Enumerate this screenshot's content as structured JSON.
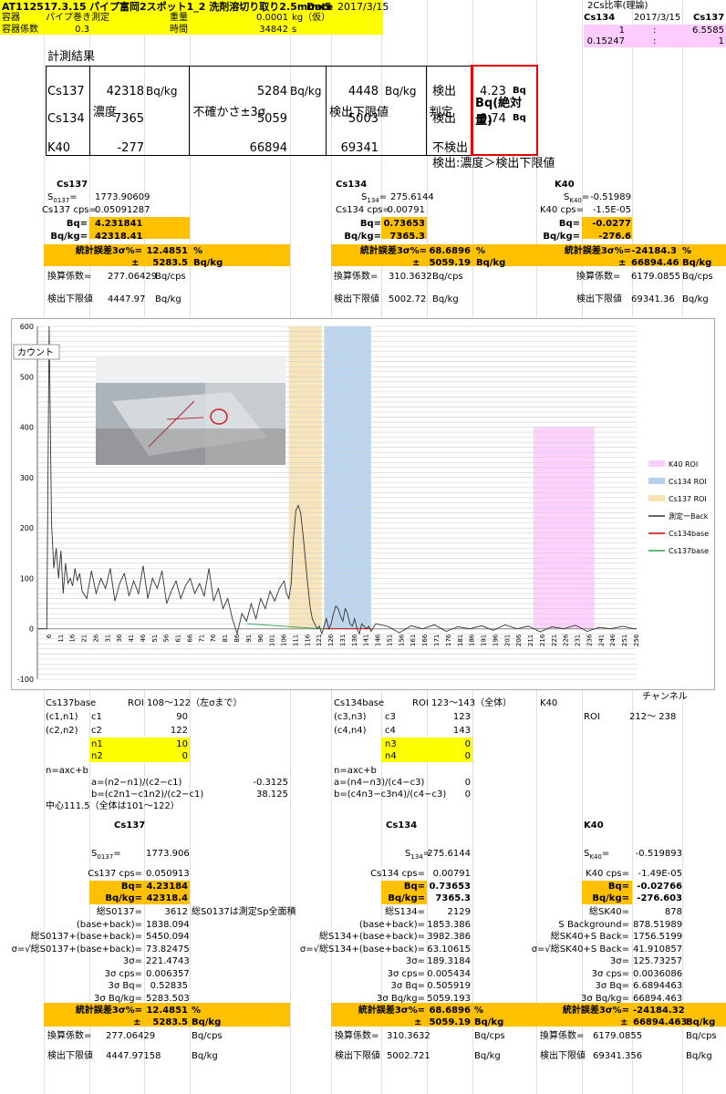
{
  "header": {
    "id": "AT1125",
    "date_code": "17.3.15",
    "title": "パイプ富岡2スポット1_2 洗剤溶切り取り2.5mmx5",
    "date_label": "Date",
    "date": "2017/3/15",
    "r2_l": "容器",
    "r2_v": "パイプ巻き測定",
    "r2_m": "重量",
    "r2_n": "0.0001",
    "r2_u": "kg（仮）",
    "r3_l": "容器係数",
    "r3_v": "0.3",
    "r3_m": "時間",
    "r3_n": "34842",
    "r3_u": "s"
  },
  "ratio": {
    "title": "2Cs比率(理論)",
    "h1": "Cs134",
    "h2": "2017/3/15",
    "h3": "Cs137",
    "r1a": "1",
    "r1b": ":",
    "r1c": "6.5585",
    "r2a": "0.15247",
    "r2b": ":",
    "r2c": "1"
  },
  "results": {
    "title": "計測結果",
    "headers": [
      "濃度",
      "不確かさ±3σ",
      "検出下限値",
      "判定",
      "Bq(絶対量)"
    ],
    "rows": [
      {
        "nuc": "Cs137",
        "conc": "42318",
        "cu": "Bq/kg",
        "unc": "5284",
        "uu": "Bq/kg",
        "lim": "4448",
        "lu": "Bq/kg",
        "judge": "検出",
        "abs": "4.23",
        "au": "Bq"
      },
      {
        "nuc": "Cs134",
        "conc": "7365",
        "cu": "",
        "unc": "5059",
        "uu": "",
        "lim": "5003",
        "lu": "",
        "judge": "検出",
        "abs": "0.74",
        "au": "Bq"
      },
      {
        "nuc": "K40",
        "conc": "-277",
        "cu": "",
        "unc": "66894",
        "uu": "",
        "lim": "69341",
        "lu": "",
        "judge": "不検出",
        "abs": "",
        "au": ""
      }
    ],
    "note": "検出:濃度＞検出下限値"
  },
  "upper": {
    "cs137": {
      "title": "Cs137",
      "s_l": "S",
      "s_sub": "0137",
      "s_v": "1773.90609",
      "cps_l": "Cs137 cps=",
      "cps_v": "0.05091287",
      "bq_l": "Bq=",
      "bq_v": "4.231841",
      "bqkg_l": "Bq/kg=",
      "bqkg_v": "42318.41",
      "err_l": "統計誤差3σ%=",
      "err_v": "12.4851",
      "err_u": "%",
      "pm": "±",
      "pm_v": "5283.5",
      "pm_u": "Bq/kg",
      "conv_l": "換算係数=",
      "conv_v": "277.06429",
      "conv_u": "Bq/cps",
      "lim_l": "検出下限値",
      "lim_v": "4447.97",
      "lim_u": "Bq/kg"
    },
    "cs134": {
      "title": "Cs134",
      "s_l": "S",
      "s_sub": "134",
      "s_v": "275.6144",
      "cps_l": "Cs134 cps=",
      "cps_v": "0.00791",
      "bq_l": "Bq=",
      "bq_v": "0.73653",
      "bqkg_l": "Bq/kg=",
      "bqkg_v": "7365.3",
      "err_l": "統計誤差3σ%=",
      "err_v": "68.6896",
      "err_u": "%",
      "pm": "±",
      "pm_v": "5059.19",
      "pm_u": "Bq/kg",
      "conv_l": "換算係数=",
      "conv_v": "310.3632",
      "conv_u": "Bq/cps",
      "lim_l": "検出下限値",
      "lim_v": "5002.72",
      "lim_u": "Bq/kg"
    },
    "k40": {
      "title": "K40",
      "s_l": "S",
      "s_sub": "K40",
      "s_v": "-0.51989",
      "cps_l": "K40 cps=",
      "cps_v": "-1.5E-05",
      "bq_l": "Bq=",
      "bq_v": "-0.0277",
      "bqkg_l": "Bq/kg=",
      "bqkg_v": "-276.6",
      "err_l": "統計誤差3σ%=",
      "err_v": "-24184.3",
      "err_u": "%",
      "pm": "±",
      "pm_v": "66894.46",
      "pm_u": "Bq/kg",
      "conv_l": "換算係数=",
      "conv_v": "6179.0855",
      "conv_u": "Bq/cps",
      "lim_l": "検出下限値",
      "lim_v": "69341.36",
      "lim_u": "Bq/kg"
    }
  },
  "chart_data": {
    "type": "line",
    "ylabel": "カウント",
    "ylim": [
      -100,
      600
    ],
    "yticks": [
      -100,
      0,
      100,
      200,
      300,
      400,
      500,
      600
    ],
    "xlim": [
      1,
      256
    ],
    "xticks": [
      "6",
      "11",
      "16",
      "21",
      "26",
      "31",
      "36",
      "41",
      "46",
      "51",
      "56",
      "61",
      "66",
      "71",
      "76",
      "81",
      "86",
      "91",
      "96",
      "101",
      "106",
      "111",
      "116",
      "121",
      "126",
      "131",
      "136",
      "141",
      "146",
      "151",
      "156",
      "161",
      "166",
      "171",
      "176",
      "181",
      "186",
      "191",
      "196",
      "201",
      "206",
      "211",
      "216",
      "221",
      "226",
      "231",
      "236",
      "241",
      "246",
      "251",
      "256"
    ],
    "rois": [
      {
        "name": "K40 ROI",
        "from": 212,
        "to": 238,
        "height": 400,
        "color": "#ffccff"
      },
      {
        "name": "Cs134 ROI",
        "from": 123,
        "to": 143,
        "height": 600,
        "color": "#b4d2ec"
      },
      {
        "name": "Cs137 ROI",
        "from": 108,
        "to": 122,
        "height": 600,
        "color": "#f8e2b4"
      }
    ],
    "series": [
      {
        "name": "測定ーBack",
        "color": "#333333",
        "x": [
          1,
          2,
          3,
          4,
          5,
          6,
          7,
          8,
          9,
          10,
          11,
          12,
          13,
          14,
          15,
          16,
          17,
          18,
          19,
          20,
          22,
          24,
          26,
          28,
          30,
          32,
          34,
          36,
          38,
          40,
          42,
          44,
          46,
          48,
          50,
          52,
          54,
          56,
          58,
          60,
          62,
          64,
          66,
          68,
          70,
          72,
          74,
          76,
          78,
          80,
          82,
          84,
          86,
          88,
          90,
          92,
          94,
          96,
          98,
          100,
          102,
          104,
          106,
          107,
          108,
          109,
          110,
          111,
          112,
          113,
          114,
          115,
          116,
          117,
          118,
          119,
          120,
          121,
          122,
          123,
          124,
          125,
          126,
          127,
          128,
          129,
          130,
          131,
          132,
          133,
          134,
          135,
          136,
          137,
          138,
          139,
          140,
          141,
          142,
          143,
          145,
          150,
          155,
          160,
          165,
          170,
          175,
          180,
          185,
          190,
          195,
          200,
          205,
          210,
          215,
          220,
          225,
          230,
          235,
          240,
          245,
          250,
          255,
          256
        ],
        "y": [
          0,
          0,
          0,
          0,
          0,
          600,
          210,
          120,
          160,
          100,
          155,
          70,
          130,
          90,
          100,
          85,
          120,
          95,
          110,
          75,
          60,
          115,
          70,
          100,
          80,
          120,
          55,
          90,
          110,
          65,
          95,
          70,
          125,
          60,
          100,
          80,
          115,
          50,
          75,
          95,
          60,
          85,
          100,
          70,
          90,
          65,
          120,
          55,
          80,
          40,
          60,
          20,
          -10,
          30,
          15,
          50,
          20,
          60,
          40,
          75,
          55,
          80,
          95,
          70,
          60,
          90,
          180,
          235,
          245,
          230,
          190,
          140,
          90,
          45,
          20,
          10,
          0,
          5,
          -10,
          5,
          20,
          0,
          10,
          30,
          45,
          40,
          25,
          15,
          40,
          30,
          10,
          5,
          20,
          0,
          -10,
          10,
          5,
          0,
          5,
          -5,
          10,
          5,
          -8,
          6,
          0,
          8,
          -5,
          4,
          0,
          6,
          -3,
          8,
          0,
          5,
          -6,
          4,
          0,
          7,
          -5,
          3,
          0,
          5,
          0,
          0
        ]
      },
      {
        "name": "Cs134base",
        "color": "#d00000",
        "x": [
          123,
          143
        ],
        "y": [
          0,
          0
        ]
      },
      {
        "name": "Cs137base",
        "color": "#30a050",
        "x": [
          90,
          122
        ],
        "y": [
          10,
          0
        ]
      }
    ],
    "legend": "right",
    "grid": true
  },
  "mid": {
    "c137_l": "Cs137base",
    "c137_roi": "ROI 108〜122（左σまで）",
    "c134_l": "Cs134base",
    "c134_roi": "ROI 123〜143（全体）",
    "k40_l": "K40",
    "k40_ch": "チャンネル",
    "k40_roi_l": "ROI",
    "k40_roi_v": "212〜 238",
    "a_c1n1": "(c1,n1)",
    "a_c1": "c1",
    "a_c1v": "90",
    "a_c2n2": "(c2,n2)",
    "a_c2": "c2",
    "a_c2v": "122",
    "a_n1": "n1",
    "a_n1v": "10",
    "a_n2": "n2",
    "a_n2v": "0",
    "b_c3n3": "(c3,n3)",
    "b_c3": "c3",
    "b_c3v": "123",
    "b_c4n4": "(c4,n4)",
    "b_c4": "c4",
    "b_c4v": "143",
    "b_n3": "n3",
    "b_n3v": "0",
    "b_n4": "n4",
    "b_n4v": "0",
    "a_eq": "n=axc+b",
    "a_a": "a=(n2−n1)/(c2−c1)",
    "a_av": "-0.3125",
    "a_b": "b=(c2n1−c1n2)/(c2−c1)",
    "a_bv": "38.125",
    "b_eq": "n=axc+b",
    "b_a": "a=(n4−n3)/(c4−c3)",
    "b_av": "0",
    "b_b": "b=(c4n3−c3n4)/(c4−c3)",
    "b_bv": "0",
    "center": "中心111.5（全体は101〜122）"
  },
  "lower": {
    "cs137": {
      "title": "Cs137",
      "s_l": "S",
      "s_sub": "0137",
      "s_v": "1773.906",
      "cps_l": "Cs137 cps=",
      "cps_v": "0.050913",
      "bq_l": "Bq=",
      "bq_v": "4.23184",
      "bqkg_l": "Bq/kg=",
      "bqkg_v": "42318.4",
      "rows": [
        [
          "総S0137=",
          "3612"
        ],
        [
          "(base+back)=",
          "1838.094"
        ],
        [
          "総S0137+(base+back)=",
          "5450.094"
        ],
        [
          "σ=√総S0137+(base+back)=",
          "73.82475"
        ],
        [
          "3σ=",
          "221.4743"
        ],
        [
          "3σ cps=",
          "0.006357"
        ],
        [
          "3σ Bq=",
          "0.52835"
        ],
        [
          "3σ Bq/kg=",
          "5283.503"
        ]
      ],
      "note": "総S0137は測定Sp全面積",
      "err_l": "統計誤差3σ%=",
      "err_v": "12.4851",
      "err_u": "%",
      "pm": "±",
      "pm_v": "5283.5",
      "pm_u": "Bq/kg",
      "conv_l": "換算係数=",
      "conv_v": "277.06429",
      "conv_u": "Bq/cps",
      "lim_l": "検出下限値",
      "lim_v": "4447.97158",
      "lim_u": "Bq/kg"
    },
    "cs134": {
      "title": "Cs134",
      "s_l": "S",
      "s_sub": "134",
      "s_v": "275.6144",
      "cps_l": "Cs134 cps=",
      "cps_v": "0.00791",
      "bq_l": "Bq=",
      "bq_v": "0.73653",
      "bqkg_l": "Bq/kg=",
      "bqkg_v": "7365.3",
      "rows": [
        [
          "総S134=",
          "2129"
        ],
        [
          "(base+back)=",
          "1853.386"
        ],
        [
          "総S134+(base+back)=",
          "3982.386"
        ],
        [
          "σ=√総S134+(base+back)=",
          "63.10615"
        ],
        [
          "3σ=",
          "189.3184"
        ],
        [
          "3σ cps=",
          "0.005434"
        ],
        [
          "3σ Bq=",
          "0.505919"
        ],
        [
          "3σ Bq/kg=",
          "5059.193"
        ]
      ],
      "err_l": "統計誤差3σ%=",
      "err_v": "68.6896",
      "err_u": "%",
      "pm": "±",
      "pm_v": "5059.19",
      "pm_u": "Bq/kg",
      "conv_l": "換算係数=",
      "conv_v": "310.3632",
      "conv_u": "Bq/cps",
      "lim_l": "検出下限値",
      "lim_v": "5002.721",
      "lim_u": "Bq/kg"
    },
    "k40": {
      "title": "K40",
      "s_l": "S",
      "s_sub": "K40",
      "s_v": "-0.519893",
      "cps_l": "K40 cps=",
      "cps_v": "-1.49E-05",
      "bq_l": "Bq=",
      "bq_v": "-0.02766",
      "bqkg_l": "Bq/kg=",
      "bqkg_v": "-276.603",
      "rows": [
        [
          "総SK40=",
          "878"
        ],
        [
          "S Background=",
          "878.51989"
        ],
        [
          "総SK40+S Back=",
          "1756.5199"
        ],
        [
          "σ=√総SK40+S Back=",
          "41.910857"
        ],
        [
          "3σ=",
          "125.73257"
        ],
        [
          "3σ cps=",
          "0.0036086"
        ],
        [
          "3σ Bq=",
          "6.6894463"
        ],
        [
          "3σ Bq/kg=",
          "66894.463"
        ]
      ],
      "err_l": "統計誤差3σ%=",
      "err_v": "-24184.32",
      "err_u": "",
      "pm": "±",
      "pm_v": "66894.463",
      "pm_u": "Bq/kg",
      "conv_l": "換算係数=",
      "conv_v": "6179.0855",
      "conv_u": "Bq/cps",
      "lim_l": "検出下限値",
      "lim_v": "69341.356",
      "lim_u": "Bq/kg"
    }
  }
}
